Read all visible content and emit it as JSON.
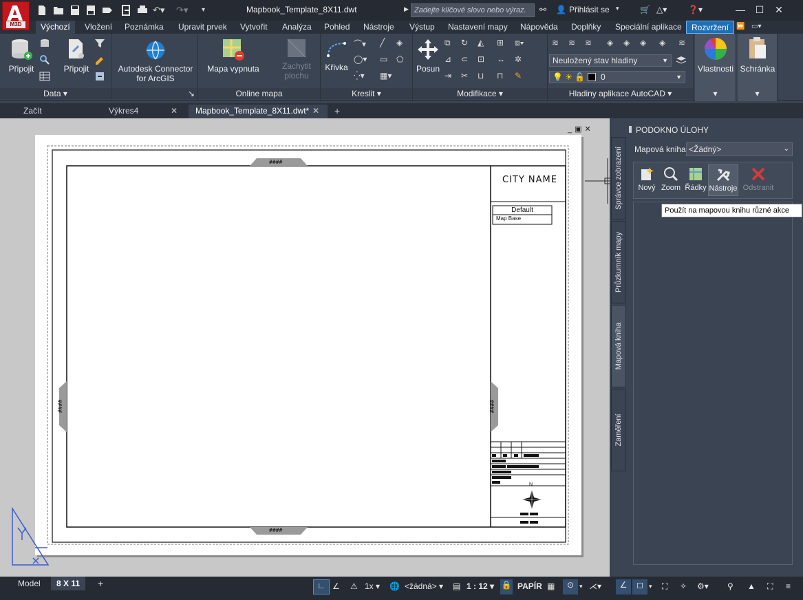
{
  "app": {
    "logo_text": "A",
    "logo_sub": "M3D",
    "doc_title": "Mapbook_Template_8X11.dwt",
    "search_placeholder": "Zadejte klíčové slovo nebo výraz.",
    "sign_in": "Přihlásit se"
  },
  "ribbon_tabs": [
    {
      "label": "Výchozí",
      "state": "active"
    },
    {
      "label": "Vložení"
    },
    {
      "label": "Poznámka"
    },
    {
      "label": "Upravit prvek"
    },
    {
      "label": "Vytvořit"
    },
    {
      "label": "Analýza"
    },
    {
      "label": "Pohled"
    },
    {
      "label": "Nástroje"
    },
    {
      "label": "Výstup"
    },
    {
      "label": "Nastavení mapy"
    },
    {
      "label": "Nápověda"
    },
    {
      "label": "Doplňky"
    },
    {
      "label": "Speciální aplikace"
    },
    {
      "label": "Rozvržení",
      "state": "highlighted"
    }
  ],
  "ribbon": {
    "data": {
      "label": "Data",
      "btn_attach1": "Připojit",
      "btn_attach2": "Připojit"
    },
    "connector": {
      "line1": "Autodesk Connector",
      "line2": "for ArcGIS"
    },
    "online": {
      "label": "Online mapa",
      "btn_map_off": "Mapa vypnuta",
      "btn_capture1": "Zachytit",
      "btn_capture2": "plochu"
    },
    "draw": {
      "label": "Kreslit",
      "btn_curve": "Křivka"
    },
    "modify": {
      "label": "Modifikace",
      "btn_move": "Posun"
    },
    "layers": {
      "label": "Hladiny aplikace AutoCAD",
      "layer_state": "Neuložený stav hladiny",
      "current_layer": "0"
    },
    "properties": {
      "label": "Vlastnosti"
    },
    "clipboard": {
      "label": "Schránka"
    }
  },
  "file_tabs": [
    {
      "label": "Začít"
    },
    {
      "label": "Výkres4"
    },
    {
      "label": "Mapbook_Template_8X11.dwt*",
      "state": "active"
    }
  ],
  "titleblock": {
    "city": "CITY NAME",
    "legend_header": "Default",
    "legend_item": "Map Base",
    "compass_n": "N",
    "marker": "####"
  },
  "side_tabs": [
    {
      "label": "Správce zobrazení"
    },
    {
      "label": "Průzkumník mapy"
    },
    {
      "label": "Mapová kniha",
      "state": "active"
    },
    {
      "label": "Zaměření"
    }
  ],
  "taskpane": {
    "header": "PODOKNO ÚLOHY",
    "mapbook_label": "Mapová kniha:",
    "mapbook_value": "<Žádný>",
    "buttons": [
      {
        "label": "Nový"
      },
      {
        "label": "Zoom"
      },
      {
        "label": "Řádky"
      },
      {
        "label": "Nástroje",
        "state": "hover"
      },
      {
        "label": "Odstranit",
        "state": "disabled"
      }
    ],
    "tooltip": "Použít na mapovou knihu různé akce"
  },
  "statusbar": {
    "tab_model": "Model",
    "tab_layout": "8 X 11",
    "scale_anno": "1x",
    "coord_sys": "<žádná>",
    "scale": "1 : 12",
    "paper": "PAPÍR"
  },
  "colors": {
    "ribbon_bg": "#3b4453",
    "titlebar_bg": "#262b33",
    "accent_blue": "#1e6fb8",
    "logo_red": "#c4161c"
  }
}
